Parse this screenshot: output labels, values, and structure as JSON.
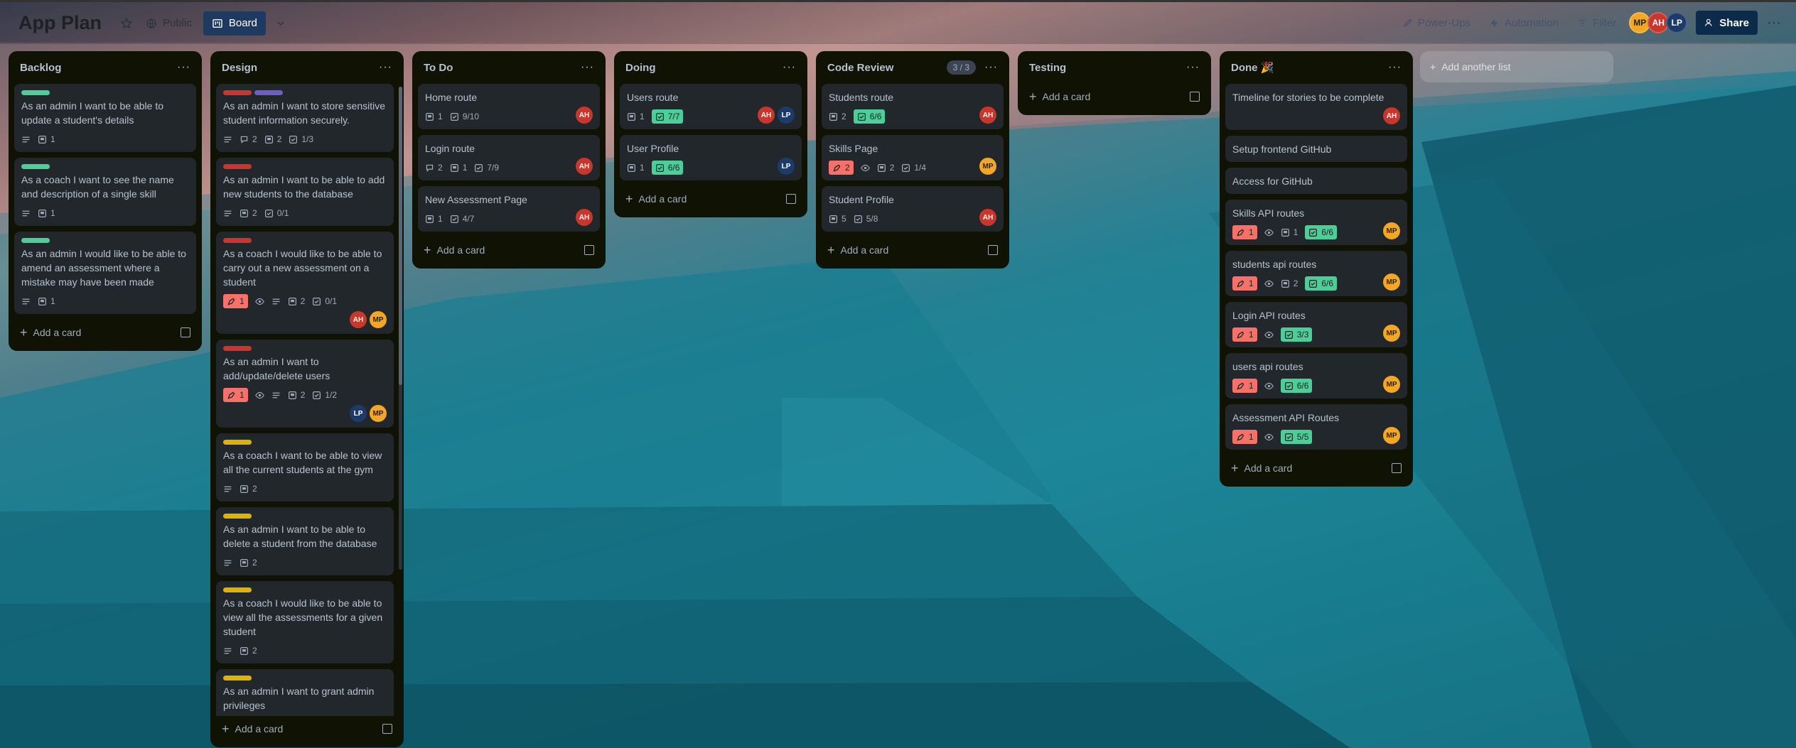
{
  "header": {
    "board_title": "App Plan",
    "visibility": "Public",
    "view": "Board",
    "power_ups": "Power-Ups",
    "automation": "Automation",
    "filter": "Filter",
    "share": "Share",
    "members": [
      "MP",
      "AH",
      "LP"
    ]
  },
  "colors": {
    "green_label": "#4bce97",
    "red_label": "#c9372c",
    "purple_label": "#6e5dc6",
    "yellow_label": "#e2b203",
    "list_bg": "#101204",
    "card_bg": "#22272b"
  },
  "add_card": "Add a card",
  "add_list": "Add another list",
  "lists": [
    {
      "title": "Backlog",
      "cards": [
        {
          "title": "As an admin I want to be able to update a student's details",
          "attachments": "1"
        },
        {
          "title": "As a coach I want to see the name and description of a single skill",
          "attachments": "1"
        },
        {
          "title": "As an admin I would like to be able to amend an assessment where a mistake may have been made",
          "attachments": "1"
        }
      ]
    },
    {
      "title": "Design",
      "cards": [
        {
          "title": "As an admin I want to store sensitive student information securely.",
          "comments": "2",
          "attachments": "2",
          "checklist": "1/3"
        },
        {
          "title": "As an admin I want to be able to add new students to the database",
          "attachments": "2",
          "checklist": "0/1"
        },
        {
          "title": "As a coach I would like to be able to carry out a new assessment on a student",
          "votes": "1",
          "attachments": "2",
          "checklist": "0/1",
          "members": [
            "AH",
            "MP"
          ]
        },
        {
          "title": "As an admin I want to add/update/delete users",
          "votes": "1",
          "attachments": "2",
          "checklist": "1/2",
          "members": [
            "LP",
            "MP"
          ]
        },
        {
          "title": "As a coach I want to be able to view all the current students at the gym",
          "attachments": "2"
        },
        {
          "title": "As an admin I want to be able to delete a student from the database",
          "attachments": "2"
        },
        {
          "title": "As a coach I would like to be able to view all the assessments for a given student",
          "attachments": "2"
        },
        {
          "title": "As an admin I want to grant admin privileges"
        }
      ]
    },
    {
      "title": "To Do",
      "cards": [
        {
          "title": "Home route",
          "attachments": "1",
          "checklist": "9/10",
          "members": [
            "AH"
          ]
        },
        {
          "title": "Login route",
          "comments": "2",
          "attachments": "1",
          "checklist": "7/9",
          "members": [
            "AH"
          ]
        },
        {
          "title": "New Assessment Page",
          "attachments": "1",
          "checklist": "4/7",
          "members": [
            "AH"
          ]
        }
      ]
    },
    {
      "title": "Doing",
      "cards": [
        {
          "title": "Users route",
          "attachments": "1",
          "checklist": "7/7",
          "members": [
            "AH",
            "LP"
          ]
        },
        {
          "title": "User Profile",
          "attachments": "1",
          "checklist": "6/6",
          "members": [
            "LP"
          ]
        }
      ]
    },
    {
      "title": "Code Review",
      "count": "3 / 3",
      "cards": [
        {
          "title": "Students route",
          "attachments": "2",
          "checklist": "6/6",
          "members": [
            "AH"
          ]
        },
        {
          "title": "Skills Page",
          "votes": "2",
          "attachments": "2",
          "checklist": "1/4",
          "members": [
            "MP"
          ]
        },
        {
          "title": "Student Profile",
          "attachments": "5",
          "checklist": "5/8",
          "members": [
            "AH"
          ]
        }
      ]
    },
    {
      "title": "Testing",
      "cards": []
    },
    {
      "title": "Done 🎉",
      "cards": [
        {
          "title": "Timeline for stories to be complete",
          "members": [
            "AH"
          ]
        },
        {
          "title": "Setup frontend GitHub"
        },
        {
          "title": "Access for GitHub"
        },
        {
          "title": "Skills API routes",
          "votes": "1",
          "attachments": "1",
          "checklist": "6/6",
          "members": [
            "MP"
          ]
        },
        {
          "title": "students api routes",
          "votes": "1",
          "attachments": "2",
          "checklist": "6/6",
          "members": [
            "MP"
          ]
        },
        {
          "title": "Login API routes",
          "votes": "1",
          "checklist": "3/3",
          "members": [
            "MP"
          ]
        },
        {
          "title": "users api routes",
          "votes": "1",
          "checklist": "6/6",
          "members": [
            "MP"
          ]
        },
        {
          "title": "Assessment API Routes",
          "votes": "1",
          "checklist": "5/5",
          "members": [
            "MP"
          ]
        }
      ]
    }
  ]
}
